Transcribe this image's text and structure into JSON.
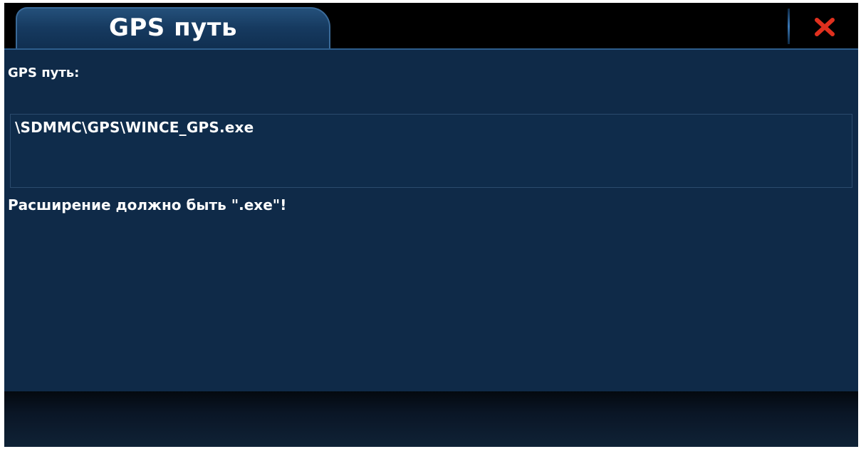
{
  "window": {
    "tab_title": "GPS путь",
    "close_icon": "close-icon",
    "close_color": "#e0301e",
    "background_color": "#0f2a48"
  },
  "form": {
    "label": "GPS путь:",
    "path_value": "\\SDMMC\\GPS\\WINCE_GPS.exe",
    "warning": "Расширение должно быть \".exe\"!"
  }
}
